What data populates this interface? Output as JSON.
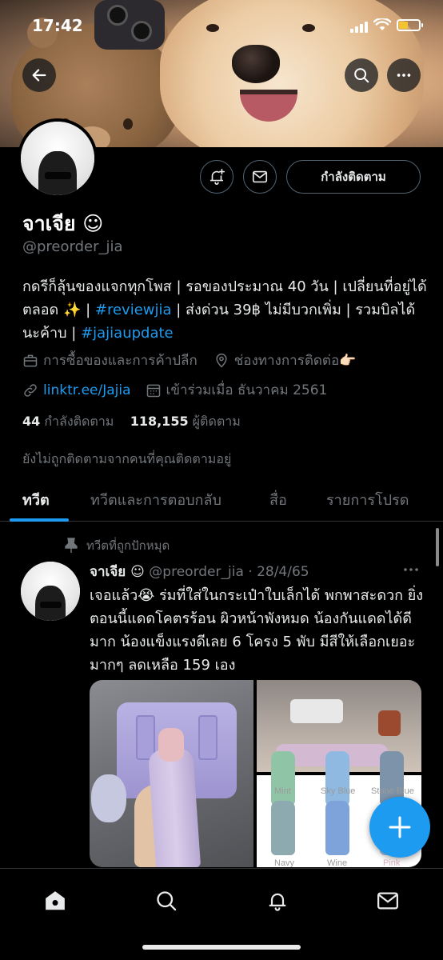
{
  "status_bar": {
    "time": "17:42"
  },
  "profile": {
    "display_name": "จาเจีย ☺︎",
    "handle": "@preorder_jia",
    "bio_part1": "กดรีก็ลุ้นของแจกทุกโพส | รอของประมาณ 40 วัน | เปลี่ยนที่อยู่ได้ตลอด ✨ | ",
    "bio_tag1": "#reviewjia",
    "bio_part2": " | ส่งด่วน 39฿ ไม่มีบวกเพิ่ม | รวมบิลได้นะค้าบ | ",
    "bio_tag2": "#jajiaupdate",
    "category": "การซื้อของและการค้าปลีก",
    "contact": "ช่องทางการติดต่อ👉🏻",
    "link": "linktr.ee/Jajia",
    "joined": "เข้าร่วมเมื่อ ธันวาคม 2561",
    "following_count": "44",
    "following_label": "กำลังติดตาม",
    "followers_count": "118,155",
    "followers_label": "ผู้ติดตาม",
    "not_followed_note": "ยังไม่ถูกติดตามจากคนที่คุณติดตามอยู่",
    "follow_button": "กำลังติดตาม"
  },
  "tabs": [
    {
      "label": "ทวีต",
      "active": true
    },
    {
      "label": "ทวีตและการตอบกลับ",
      "active": false
    },
    {
      "label": "สื่อ",
      "active": false
    },
    {
      "label": "รายการโปรด",
      "active": false
    }
  ],
  "tweet": {
    "pinned_label": "ทวีตที่ถูกปักหมุด",
    "name": "จาเจีย ☺︎",
    "handle": "@preorder_jia",
    "date": "· 28/4/65",
    "text": "เจอแล้ว😭 ร่มที่ใส่ในกระเป๋าใบเล็กได้ พกพาสะดวก ยิ่งตอนนี้แดดโคตรร้อน ผิวหน้าพังหมด น้องกันแดดได้ดีมาก น้องแข็งแรงดีเลย 6 โครง 5 พับ มีสีให้เลือกเยอะมากๆ ลดเหลือ 159 เอง",
    "swatches": {
      "mint": "Mint",
      "sky_blue": "Sky Blue",
      "stone_blue": "Stone Blue",
      "navy": "Navy",
      "wine": "Wine",
      "pink": "Pink"
    }
  },
  "icons": {
    "back": "back-arrow-icon",
    "search": "search-icon",
    "more": "more-icon",
    "bell": "bell-plus-icon",
    "message": "envelope-icon",
    "compose": "plus-icon",
    "home": "home-icon",
    "explore": "search-icon",
    "notifications": "bell-icon",
    "mail": "envelope-icon"
  },
  "colors": {
    "accent": "#1d9bf0",
    "background": "#000000",
    "secondary_text": "#71767b"
  }
}
